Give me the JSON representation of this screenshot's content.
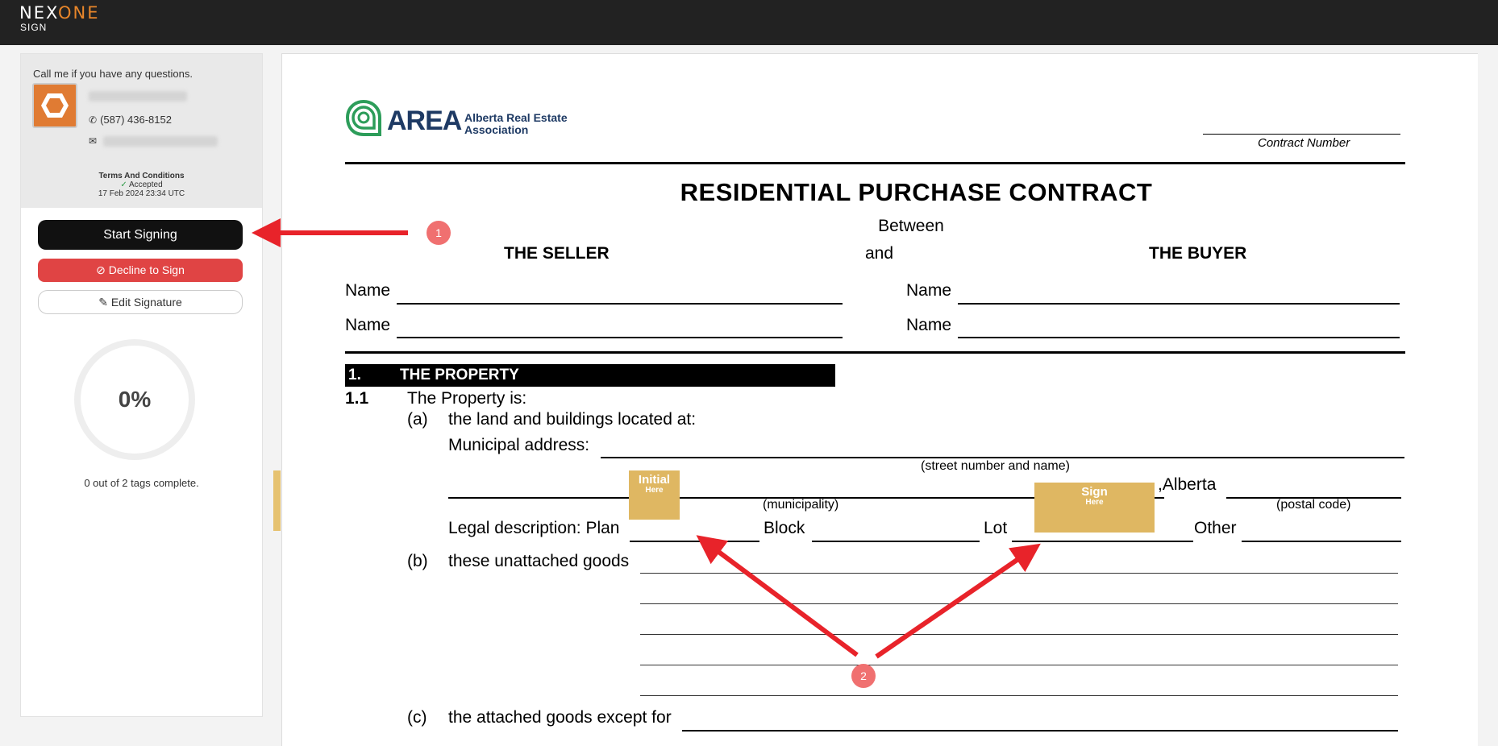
{
  "header": {
    "logo_nex": "NEX",
    "logo_one": "ONE",
    "logo_sub": "SIGN"
  },
  "sidebar": {
    "agent_prompt": "Call me if you have any questions.",
    "phone": "(587) 436-8152",
    "terms_title": "Terms And Conditions",
    "terms_status": "Accepted",
    "terms_date": "17 Feb 2024 23:34 UTC",
    "start_button": "Start Signing",
    "decline_button": "Decline to Sign",
    "edit_button": "Edit Signature",
    "progress_percent": "0%",
    "tags_complete": "0 out of 2 tags complete."
  },
  "document": {
    "area_acronym": "AREA",
    "area_name_line1": "Alberta Real Estate",
    "area_name_line2": "Association",
    "contract_number_label": "Contract Number",
    "title": "RESIDENTIAL PURCHASE CONTRACT",
    "between": "Between",
    "seller": "THE SELLER",
    "and": "and",
    "buyer": "THE BUYER",
    "name_label": "Name",
    "section1_num": "1.",
    "section1_title": "THE PROPERTY",
    "s11_num": "1.1",
    "s11_text": "The Property is:",
    "a_label": "(a)",
    "a_text": "the land and buildings located at:",
    "municipal_address": "Municipal address:",
    "street_caption": "(street number and name)",
    "alberta": ",Alberta",
    "municipality_caption": "(municipality)",
    "postal_caption": "(postal code)",
    "legal_plan": "Legal description: Plan",
    "block": "Block",
    "lot": "Lot",
    "other": "Other",
    "b_label": "(b)",
    "b_text": "these unattached goods",
    "c_label": "(c)",
    "c_text": "the attached goods except for"
  },
  "tags": {
    "initial_big": "Initial",
    "initial_small": "Here",
    "sign_big": "Sign",
    "sign_small": "Here"
  },
  "annotations": {
    "badge1": "1",
    "badge2": "2"
  },
  "colors": {
    "accent": "#e8862a",
    "decline": "#e04444",
    "tag": "#dfb762",
    "arrow": "#e8232a"
  }
}
